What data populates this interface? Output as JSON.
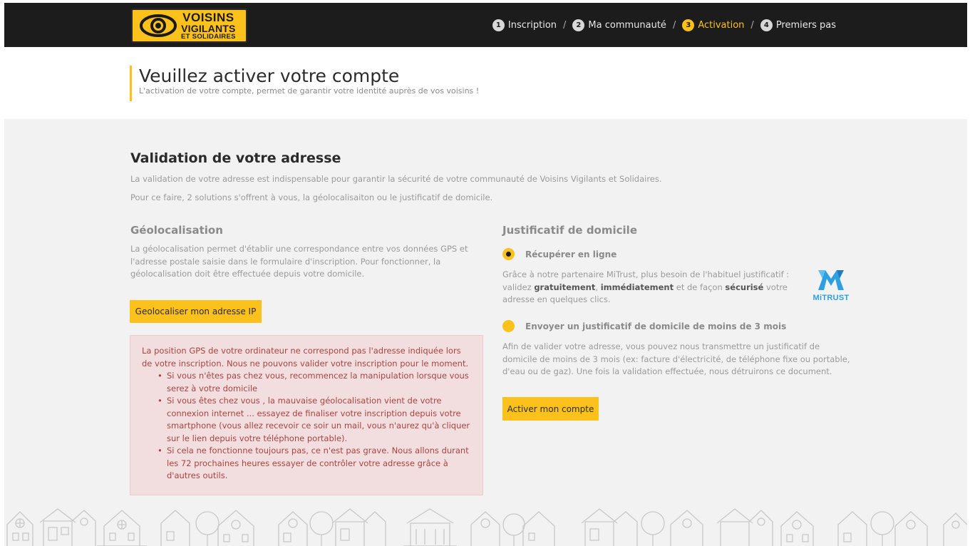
{
  "header": {
    "logo": {
      "line1": "VOISINS",
      "line2": "VIGILANTS",
      "line3": "ET SOLIDAIRES"
    },
    "steps": [
      {
        "num": "1",
        "label": "Inscription"
      },
      {
        "num": "2",
        "label": "Ma communauté"
      },
      {
        "num": "3",
        "label": "Activation"
      },
      {
        "num": "4",
        "label": "Premiers pas"
      }
    ],
    "step_separator": "/",
    "colors": {
      "bar": "#1c1c1c",
      "accent": "#fcc21b"
    }
  },
  "page": {
    "title": "Veuillez activer votre compte",
    "subtitle": "L'activation de votre compte, permet de garantir votre identité auprès de vos voisins !"
  },
  "validation": {
    "title": "Validation de votre adresse",
    "p1": "La validation de votre adresse est indispensable pour garantir la sécurité de votre communauté de Voisins Vigilants et Solidaires.",
    "p2": "Pour ce faire, 2 solutions s'offrent à vous, la géolocalisaiton ou le justificatif de domicile."
  },
  "geolocation": {
    "title": "Géolocalisation",
    "text": "La géolocalisation permet d'établir une correspondance entre vos données GPS et l'adresse postale saisie dans le formulaire d'inscription. Pour fonctionner, la géolocalisation doit être effectuée depuis votre domicile.",
    "button": "Geolocaliser mon adresse IP",
    "alert": {
      "intro": "La position GPS de votre ordinateur ne correspond pas l'adresse indiquée lors de votre inscription. Nous ne pouvons valider votre inscription pour le moment.",
      "items": [
        "Si vous n'êtes pas chez vous, recommencez la manipulation lorsque vous serez à votre domicile",
        "Si vous êtes chez vous , la mauvaise géolocalisation vient de votre connexion internet ... essayez de finaliser votre inscription depuis votre smartphone (vous allez recevoir ce soir un mail, vous n'aurez qu'à cliquer sur le lien depuis votre téléphone portable).",
        "Si cela ne fonctionne toujours pas, ce n'est pas grave. Nous allons durant les 72 prochaines heures essayer de contrôler votre adresse grâce à d'autres outils."
      ]
    }
  },
  "proof": {
    "title": "Justificatif de domicile",
    "option1": {
      "label": "Récupérer en ligne",
      "checked": true,
      "text_1": "Grâce à notre partenaire MiTrust, plus besoin de l'habituel justificatif : validez ",
      "bold_1": "gratuitement",
      "text_2": ", ",
      "bold_2": "immédiatement",
      "text_3": " et de façon ",
      "bold_3": "sécurisé",
      "text_4": " votre adresse en quelques clics.",
      "partner_logo": "MiTRUST"
    },
    "option2": {
      "label": "Envoyer un justificatif de domicile de moins de 3 mois",
      "checked": false,
      "text": "Afin de valider votre adresse, vous pouvez nous transmettre un justificatif de domicile de moins de 3 mois (ex: facture d'électricité, de téléphone fixe ou portable, d'eau ou de gaz). Une fois la validation effectuée, nous détruirons ce document."
    },
    "button": "Activer mon compte"
  }
}
